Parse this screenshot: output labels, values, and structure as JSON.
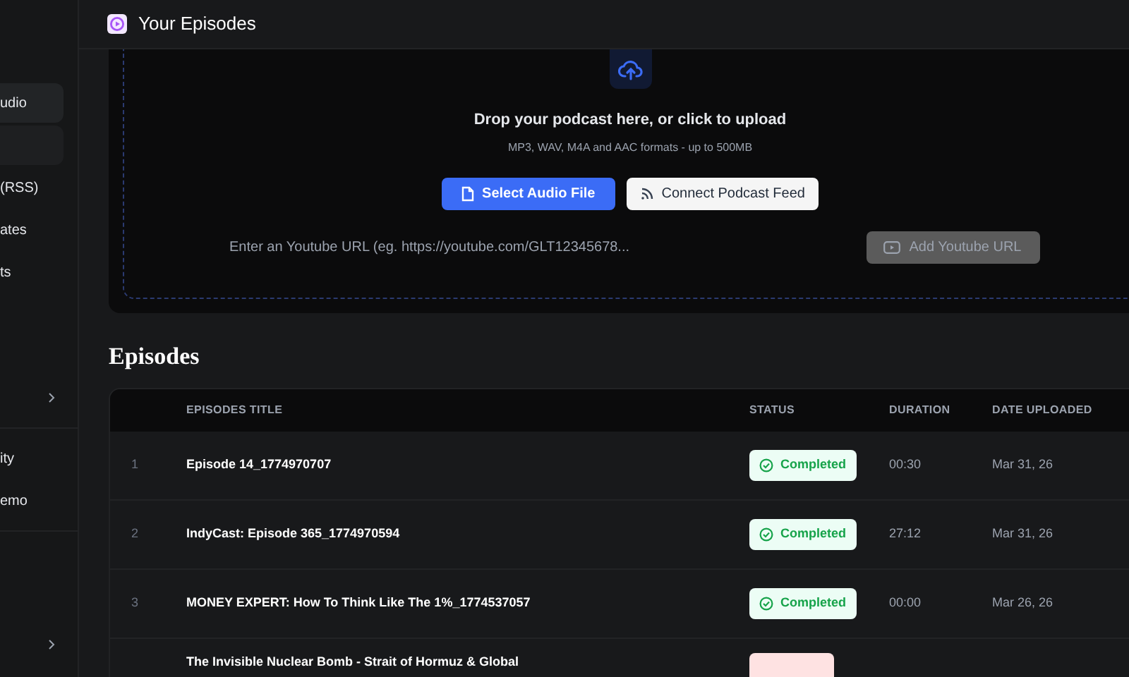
{
  "sidebar": {
    "items": [
      {
        "kind": "link",
        "label": "udio",
        "selected": true
      },
      {
        "kind": "blank"
      },
      {
        "kind": "link",
        "label": "(RSS)",
        "selected": false
      },
      {
        "kind": "link",
        "label": "ates",
        "selected": false
      },
      {
        "kind": "link",
        "label": "ts",
        "selected": false
      },
      {
        "kind": "expandable",
        "selected": false
      },
      {
        "kind": "divider"
      },
      {
        "kind": "link",
        "label": "ity",
        "selected": false
      },
      {
        "kind": "link",
        "label": "emo",
        "selected": false
      },
      {
        "kind": "divider"
      },
      {
        "kind": "expandable",
        "selected": false
      }
    ]
  },
  "header": {
    "title": "Your Episodes"
  },
  "upload": {
    "title": "Drop your podcast here, or click to upload",
    "subtitle": "MP3, WAV, M4A and AAC formats - up to 500MB",
    "primary_button": "Select Audio File",
    "secondary_button": "Connect Podcast Feed",
    "youtube_field": {
      "placeholder": "Enter an Youtube URL (eg. https://youtube.com/GLT12345678..."
    },
    "youtube_button": {
      "label": "Add Youtube URL",
      "disabled": true
    }
  },
  "episodes": {
    "title": "Episodes",
    "columns": [
      "EPISODES TITLE",
      "STATUS",
      "DURATION",
      "DATE UPLOADED"
    ],
    "rows": [
      {
        "number": "1",
        "title": "Episode 14_1774970707",
        "status": {
          "kind": "completed",
          "label": "Completed"
        },
        "duration": "00:30",
        "date": "Mar 31, 26"
      },
      {
        "number": "2",
        "title": "IndyCast: Episode 365_1774970594",
        "status": {
          "kind": "completed",
          "label": "Completed"
        },
        "duration": "27:12",
        "date": "Mar 31, 26"
      },
      {
        "number": "3",
        "title": "MONEY EXPERT: How To Think Like The 1%_1774537057",
        "status": {
          "kind": "completed",
          "label": "Completed"
        },
        "duration": "00:00",
        "date": "Mar 26, 26"
      },
      {
        "title": "The Invisible Nuclear Bomb - Strait of Hormuz & Global",
        "status": {
          "kind": "failed"
        }
      }
    ]
  }
}
